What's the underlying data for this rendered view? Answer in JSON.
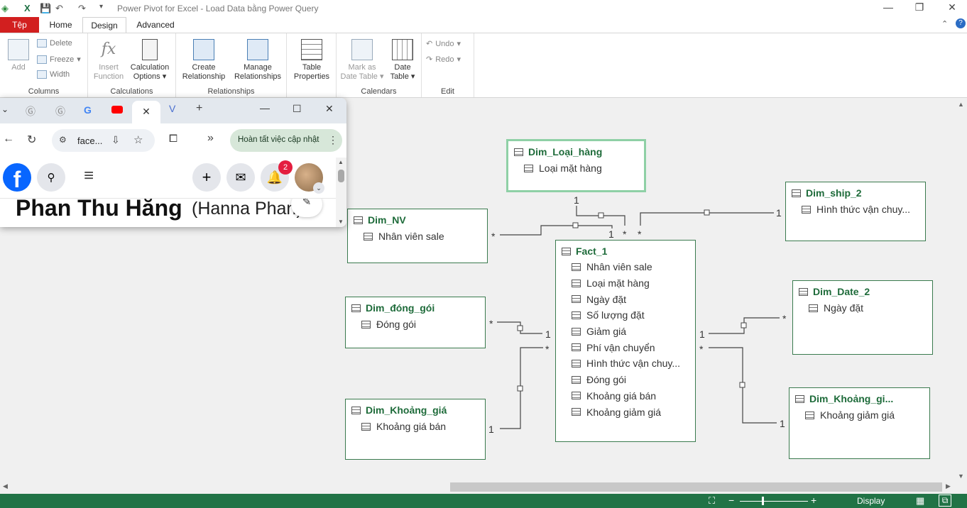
{
  "window": {
    "title": "Power Pivot for Excel - Load Data bằng Power Query"
  },
  "ribbon_tabs": [
    "Tệp",
    "Home",
    "Design",
    "Advanced"
  ],
  "ribbon": {
    "columns": {
      "add": "Add",
      "delete": "Delete",
      "freeze": "Freeze",
      "width": "Width",
      "label": "Columns"
    },
    "calculations": {
      "insert_function_1": "Insert",
      "insert_function_2": "Function",
      "calc_options_1": "Calculation",
      "calc_options_2": "Options",
      "label": "Calculations"
    },
    "relationships": {
      "create_1": "Create",
      "create_2": "Relationship",
      "manage_1": "Manage",
      "manage_2": "Relationships",
      "label": "Relationships"
    },
    "table_properties": {
      "line1": "Table",
      "line2": "Properties"
    },
    "calendars": {
      "mark_1": "Mark as",
      "mark_2": "Date Table",
      "date_1": "Date",
      "date_2": "Table",
      "label": "Calendars"
    },
    "edit": {
      "undo": "Undo",
      "redo": "Redo",
      "label": "Edit"
    }
  },
  "tables": {
    "dim_loai_hang": {
      "name": "Dim_Loại_hàng",
      "columns": [
        "Loại mặt hàng"
      ]
    },
    "dim_ship_2": {
      "name": "Dim_ship_2",
      "columns": [
        "Hình thức vận chuy..."
      ]
    },
    "dim_nv": {
      "name": "Dim_NV",
      "columns": [
        "Nhân viên sale"
      ]
    },
    "fact_1": {
      "name": "Fact_1",
      "columns": [
        "Nhân viên sale",
        "Loại mặt hàng",
        "Ngày đặt",
        "Số lượng đặt",
        "Giảm giá",
        "Phí vận chuyển",
        "Hình thức vận chuy...",
        "Đóng gói",
        "Khoảng giá bán",
        "Khoảng giảm giá"
      ]
    },
    "dim_dong_goi": {
      "name": "Dim_đóng_gói",
      "columns": [
        "Đóng gói"
      ]
    },
    "dim_date_2": {
      "name": "Dim_Date_2",
      "columns": [
        "Ngày đặt"
      ]
    },
    "dim_khoang_gia": {
      "name": "Dim_Khoảng_giá",
      "columns": [
        "Khoảng giá bán"
      ]
    },
    "dim_khoang_gi": {
      "name": "Dim_Khoảng_gi...",
      "columns": [
        "Khoảng giảm giá"
      ]
    }
  },
  "relationship_labels": {
    "one": "1",
    "many": "*"
  },
  "browser": {
    "address": "face...",
    "update_button": "Hoàn tất việc cập nhật",
    "notification_count": "2",
    "profile_name": "Phan Thu Hằng",
    "profile_alt_name": "(Hanna Phan)"
  },
  "status": {
    "display": "Display"
  },
  "colors": {
    "excel_green": "#217346",
    "table_header": "#1e6b3a",
    "file_tab": "#d21f1f",
    "facebook_blue": "#0866ff",
    "badge_red": "#e41e3f"
  }
}
